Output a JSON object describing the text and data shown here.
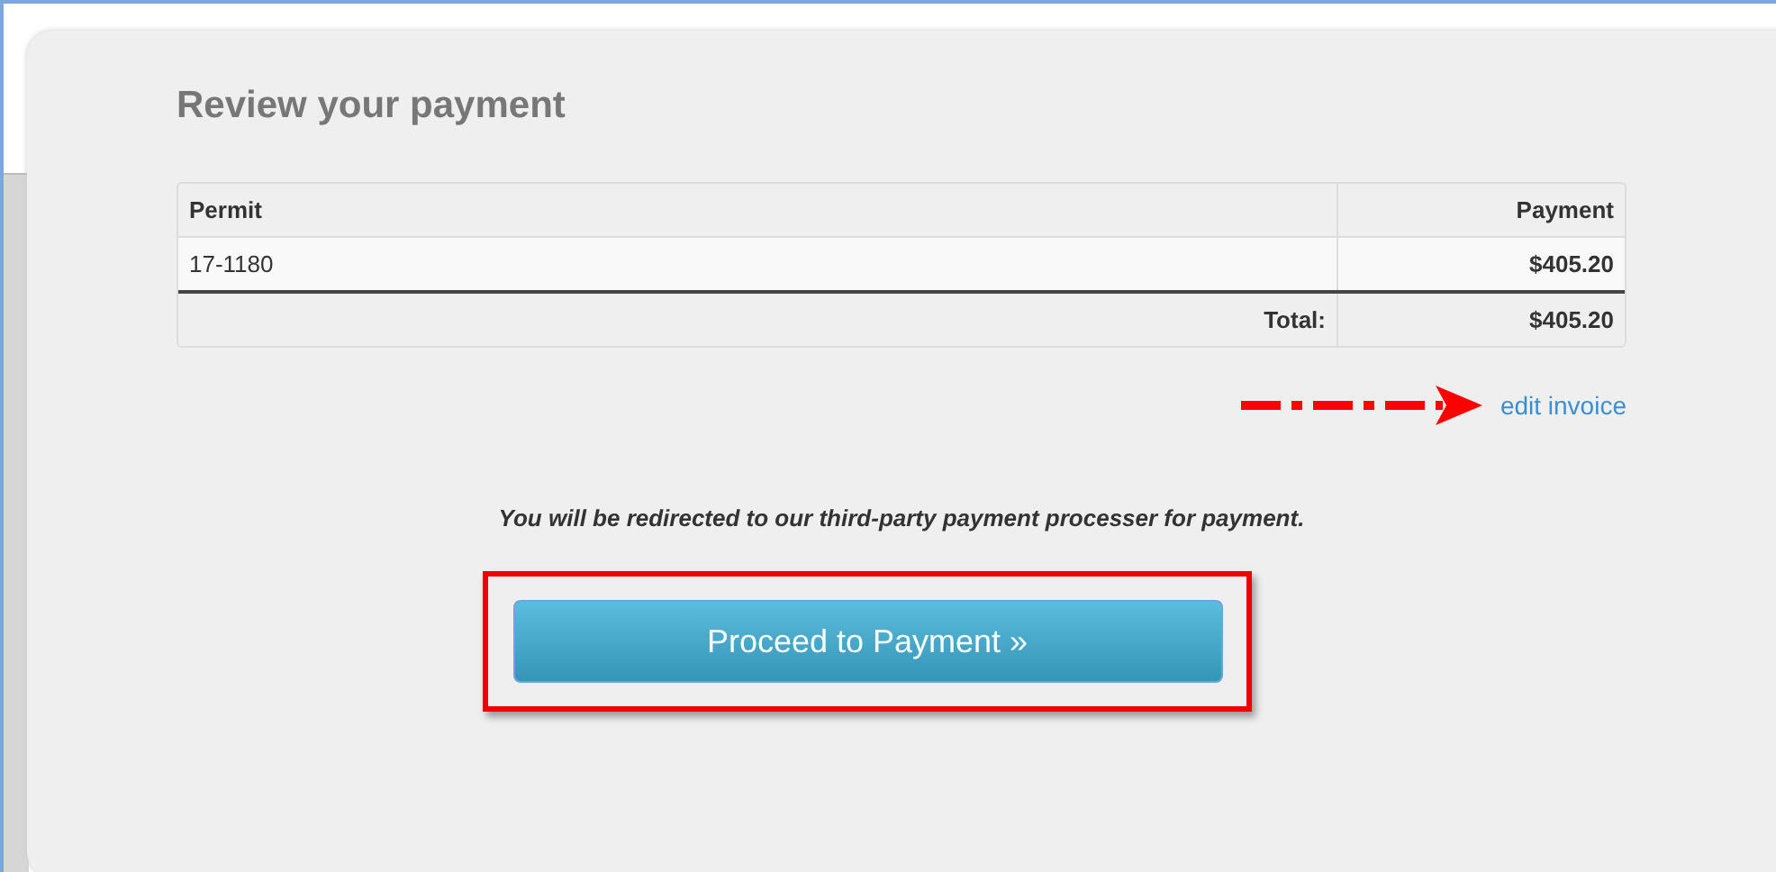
{
  "title": "Review your payment",
  "table": {
    "columns": [
      "Permit",
      "Payment"
    ],
    "rows": [
      {
        "permit": "17-1180",
        "payment": "$405.20"
      }
    ],
    "total": {
      "label": "Total:",
      "value": "$405.20"
    }
  },
  "edit_link": "edit invoice",
  "notice": "You will be redirected to our third-party payment processer for payment.",
  "button": "Proceed to Payment »"
}
